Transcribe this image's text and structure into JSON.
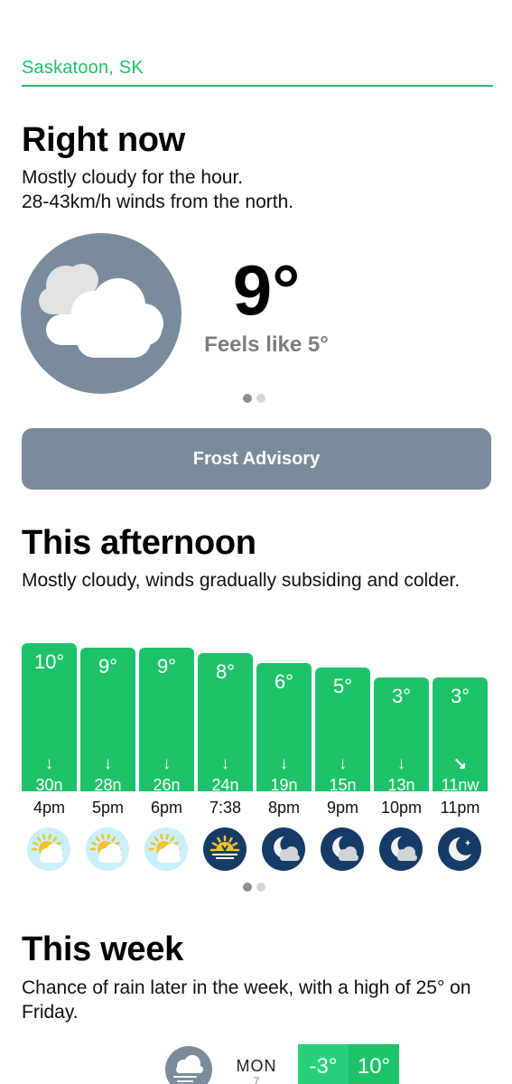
{
  "location": "Saskatoon, SK",
  "now": {
    "heading": "Right now",
    "summary_line1": "Mostly cloudy for the hour.",
    "summary_line2": "28-43km/h winds from the north.",
    "icon": "cloudy-icon",
    "temp": "9°",
    "feels_like": "Feels like 5°",
    "pager": {
      "count": 2,
      "active": 0
    }
  },
  "advisory": {
    "label": "Frost Advisory"
  },
  "afternoon": {
    "heading": "This afternoon",
    "summary": "Mostly cloudy, winds gradually subsiding and colder.",
    "hours": [
      {
        "time": "4pm",
        "temp": "10°",
        "temp_value": 10,
        "arrow": "↓",
        "wind": "30n",
        "icon": "partly-sunny-icon"
      },
      {
        "time": "5pm",
        "temp": "9°",
        "temp_value": 9,
        "arrow": "↓",
        "wind": "28n",
        "icon": "partly-sunny-icon"
      },
      {
        "time": "6pm",
        "temp": "9°",
        "temp_value": 9,
        "arrow": "↓",
        "wind": "26n",
        "icon": "partly-sunny-icon"
      },
      {
        "time": "7:38",
        "temp": "8°",
        "temp_value": 8,
        "arrow": "↓",
        "wind": "24n",
        "icon": "sunset-icon"
      },
      {
        "time": "8pm",
        "temp": "6°",
        "temp_value": 6,
        "arrow": "↓",
        "wind": "19n",
        "icon": "partly-cloudy-night-icon"
      },
      {
        "time": "9pm",
        "temp": "5°",
        "temp_value": 5,
        "arrow": "↓",
        "wind": "15n",
        "icon": "partly-cloudy-night-icon"
      },
      {
        "time": "10pm",
        "temp": "3°",
        "temp_value": 3,
        "arrow": "↓",
        "wind": "13n",
        "icon": "partly-cloudy-night-icon"
      },
      {
        "time": "11pm",
        "temp": "3°",
        "temp_value": 3,
        "arrow": "↘",
        "wind": "11nw",
        "icon": "clear-night-icon"
      }
    ],
    "pager": {
      "count": 2,
      "active": 0
    }
  },
  "week": {
    "heading": "This week",
    "summary": "Chance of rain later in the week, with a high of 25° on Friday.",
    "days": [
      {
        "day": "MON",
        "date": "7",
        "low": "-3°",
        "high": "10°",
        "icon": "windy-cloud-icon"
      }
    ]
  },
  "colors": {
    "accent": "#1ec26a",
    "accent_light": "#28d07a",
    "slate": "#7a8c9c",
    "night": "#163b66",
    "day_bg": "#c9f0fb",
    "sun": "#f5c22b"
  }
}
